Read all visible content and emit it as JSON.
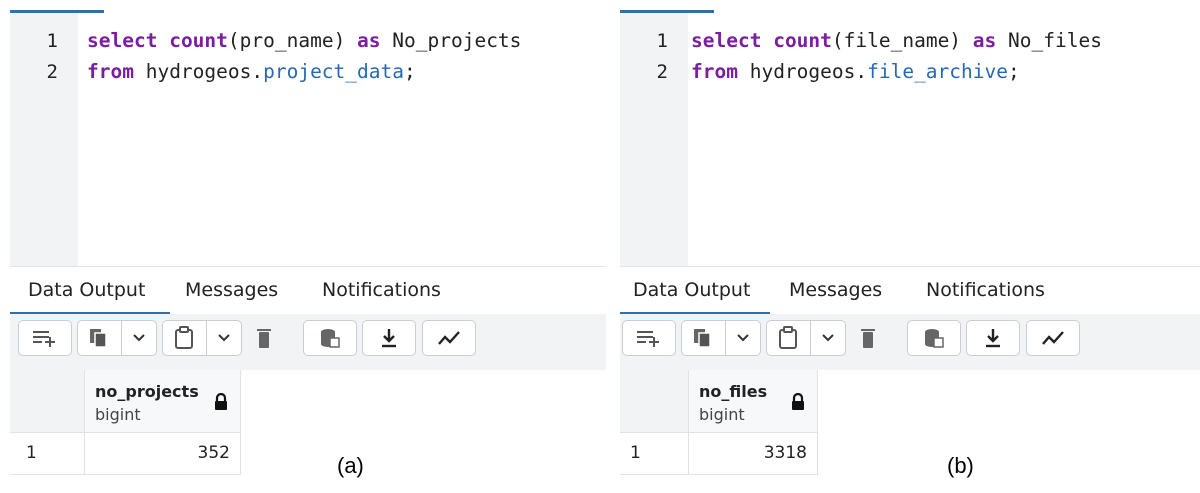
{
  "panels": [
    {
      "line_numbers": [
        "1",
        "2"
      ],
      "sql": {
        "l1_kw1": "select",
        "l1_kw2": "count",
        "l1_args": "(pro_name) ",
        "l1_kw3": "as",
        "l1_alias": " No_projects",
        "l2_kw": "from",
        "l2_schema": " hydrogeos.",
        "l2_table": "project_data",
        "l2_end": ";"
      },
      "tabs": [
        "Data Output",
        "Messages",
        "Notifications"
      ],
      "column": {
        "name": "no_projects",
        "type": "bigint"
      },
      "rows": [
        {
          "num": "1",
          "value": "352"
        }
      ],
      "caption": "(a)"
    },
    {
      "line_numbers": [
        "1",
        "2"
      ],
      "sql": {
        "l1_kw1": "select",
        "l1_kw2": "count",
        "l1_args": "(file_name) ",
        "l1_kw3": "as",
        "l1_alias": " No_files",
        "l2_kw": "from",
        "l2_schema": " hydrogeos.",
        "l2_table": "file_archive",
        "l2_end": ";"
      },
      "tabs": [
        "Data Output",
        "Messages",
        "Notifications"
      ],
      "column": {
        "name": "no_files",
        "type": "bigint"
      },
      "rows": [
        {
          "num": "1",
          "value": "3318"
        }
      ],
      "caption": "(b)"
    }
  ],
  "toolbar_icons": [
    "add-row-icon",
    "copy-icon",
    "chevron-down-icon",
    "paste-icon",
    "chevron-down-icon",
    "delete-icon",
    "save-data-icon",
    "download-icon",
    "graph-icon"
  ],
  "colors": {
    "accent": "#356ea6",
    "keyword": "#7b1fa2",
    "identifier": "#2769b5"
  }
}
